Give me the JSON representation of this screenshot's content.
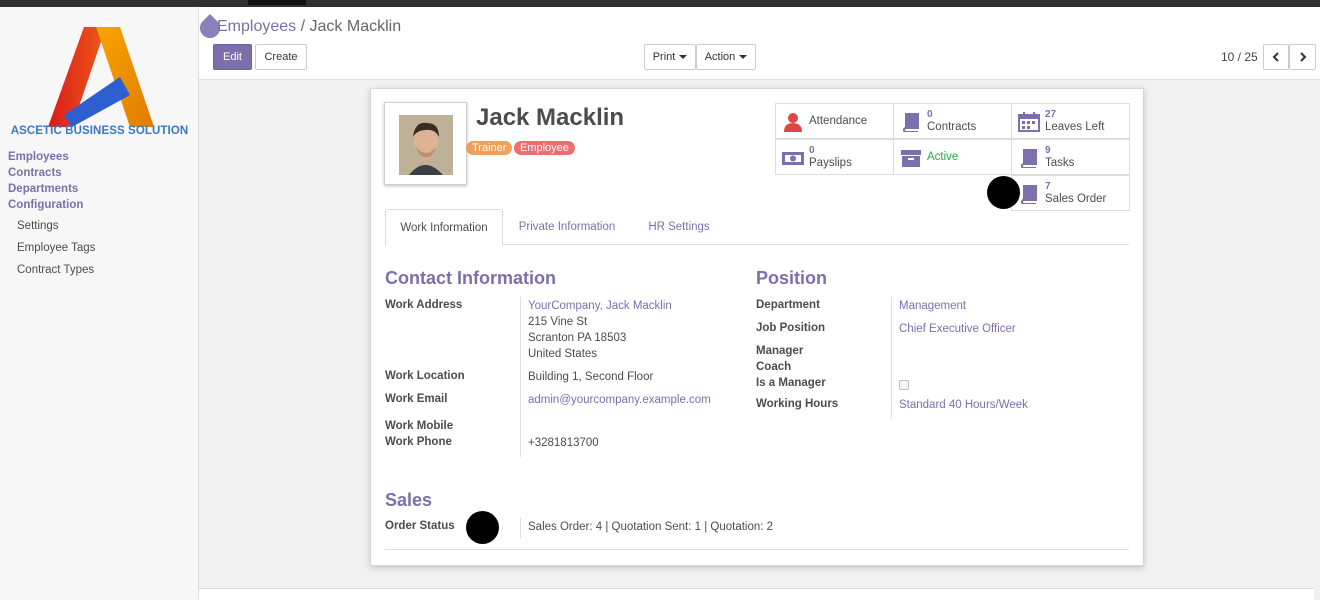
{
  "logo": {
    "text": "ASCETIC BUSINESS SOLUTION"
  },
  "sidebar": {
    "groups": [
      {
        "label": "Employees"
      },
      {
        "label": "Contracts"
      },
      {
        "label": "Departments"
      },
      {
        "label": "Configuration"
      }
    ],
    "subitems": [
      {
        "label": "Settings"
      },
      {
        "label": "Employee Tags"
      },
      {
        "label": "Contract Types"
      }
    ]
  },
  "breadcrumb": {
    "parent": "Employees",
    "separator": "/",
    "current": "Jack Macklin"
  },
  "toolbar": {
    "edit_label": "Edit",
    "create_label": "Create",
    "print_label": "Print",
    "action_label": "Action"
  },
  "pager": {
    "value": "10 / 25"
  },
  "employee": {
    "name": "Jack Macklin",
    "tags": [
      {
        "label": "Trainer",
        "color": "#f0a05a"
      },
      {
        "label": "Employee",
        "color": "#ec6e6e"
      }
    ]
  },
  "smart_buttons": {
    "attendance": {
      "label": "Attendance",
      "icon": "user-icon",
      "color": "#e04545"
    },
    "contracts": {
      "count": "0",
      "label": "Contracts",
      "icon": "book-icon"
    },
    "leaves": {
      "count": "27",
      "label": "Leaves Left",
      "icon": "calendar-icon"
    },
    "payslips": {
      "count": "0",
      "label": "Payslips",
      "icon": "money-icon"
    },
    "active": {
      "label": "Active",
      "icon": "archive-icon",
      "color": "#28a745"
    },
    "tasks": {
      "count": "9",
      "label": "Tasks",
      "icon": "book-icon"
    },
    "sales_order": {
      "count": "7",
      "label": "Sales Order",
      "icon": "book-icon"
    }
  },
  "tabs": [
    {
      "label": "Work Information"
    },
    {
      "label": "Private Information"
    },
    {
      "label": "HR Settings"
    }
  ],
  "contact": {
    "title": "Contact Information",
    "work_address_label": "Work Address",
    "address_link": "YourCompany, Jack Macklin",
    "address_line1": "215 Vine St",
    "address_line2": "Scranton PA 18503",
    "address_line3": "United States",
    "work_location_label": "Work Location",
    "work_location": "Building 1, Second Floor",
    "work_email_label": "Work Email",
    "work_email": "admin@yourcompany.example.com",
    "work_mobile_label": "Work Mobile",
    "work_phone_label": "Work Phone",
    "work_phone": "+3281813700"
  },
  "position": {
    "title": "Position",
    "department_label": "Department",
    "department": "Management",
    "job_position_label": "Job Position",
    "job_position": "Chief Executive Officer",
    "manager_label": "Manager",
    "coach_label": "Coach",
    "is_manager_label": "Is a Manager",
    "working_hours_label": "Working Hours",
    "working_hours": "Standard 40 Hours/Week"
  },
  "sales": {
    "title": "Sales",
    "order_status_label": "Order Status",
    "order_status": "Sales Order: 4 | Quotation Sent: 1 | Quotation: 2"
  },
  "colors": {
    "brand": "#7c6fab"
  }
}
